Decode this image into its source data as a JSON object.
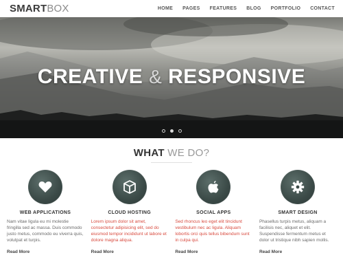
{
  "header": {
    "logo_bold": "SMART",
    "logo_light": "BOX",
    "nav": [
      {
        "label": "HOME"
      },
      {
        "label": "PAGES"
      },
      {
        "label": "FEATURES"
      },
      {
        "label": "BLOG"
      },
      {
        "label": "PORTFOLIO"
      },
      {
        "label": "CONTACT"
      }
    ]
  },
  "hero": {
    "title_left": "CREATIVE",
    "title_amp": "&",
    "title_right": "RESPONSIVE",
    "slides": 3,
    "active_slide": 2
  },
  "section": {
    "title_bold": "WHAT",
    "title_light": "WE DO?"
  },
  "features": [
    {
      "icon": "heart-icon",
      "title": "WEB APPLICATIONS",
      "text": "Nam vitae ligula eu mi molestie fringilla sed ac massa. Duis commodo justo metus, commodo eu viverra quis, volutpat et turpis.",
      "link": "Read More"
    },
    {
      "icon": "cube-icon",
      "title": "CLOUD HOSTING",
      "text": "Lorem ipsum dolor sit amet, consectetur adipisicing elit, sed do eiusmod tempor incididunt ut labore et dolore magna aliqua.",
      "link": "Read More"
    },
    {
      "icon": "apple-icon",
      "title": "SOCIAL APPS",
      "text": "Sed rhoncus leo eget elit tincidunt vestibulum nec ac ligula. Aliquam lobortis orci quis tellus bibendum sunt in culpa qui.",
      "link": "Read More"
    },
    {
      "icon": "gear-icon",
      "title": "SMART DESIGN",
      "text": "Phasellus turpis metus, aliquam a facilisis nec, aliquet et elit. Suspendisse fermentum metus et dolor ut tristique nibh sapien mollis.",
      "link": "Read More"
    }
  ],
  "colors": {
    "accent_red": "#d84a3e",
    "icon_circle": "#3b4a47"
  }
}
